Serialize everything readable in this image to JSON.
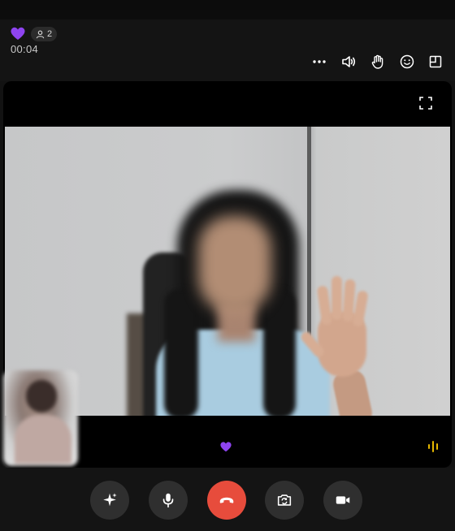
{
  "header": {
    "participant_count": "2",
    "timer": "00:04"
  },
  "icons": {
    "heart_badge": "purple-heart-icon",
    "participants": "person-icon",
    "more": "more-dots-icon",
    "speaker": "speaker-icon",
    "raise_hand": "raise-hand-icon",
    "reactions": "smiley-icon",
    "layout": "layout-icon",
    "fullscreen": "fullscreen-icon",
    "heart_center": "purple-heart-icon",
    "audio_level": "audio-wave-icon"
  },
  "controls": [
    {
      "name": "effects",
      "icon": "sparkle-icon"
    },
    {
      "name": "microphone",
      "icon": "mic-icon"
    },
    {
      "name": "end-call",
      "icon": "phone-hangup-icon"
    },
    {
      "name": "flip-camera",
      "icon": "camera-flip-icon"
    },
    {
      "name": "video",
      "icon": "video-camera-icon"
    }
  ],
  "colors": {
    "accent_purple": "#8e44f0",
    "end_call_red": "#e74c3c",
    "audio_wave": "#e6b800",
    "button_bg": "#2f2f2f"
  }
}
